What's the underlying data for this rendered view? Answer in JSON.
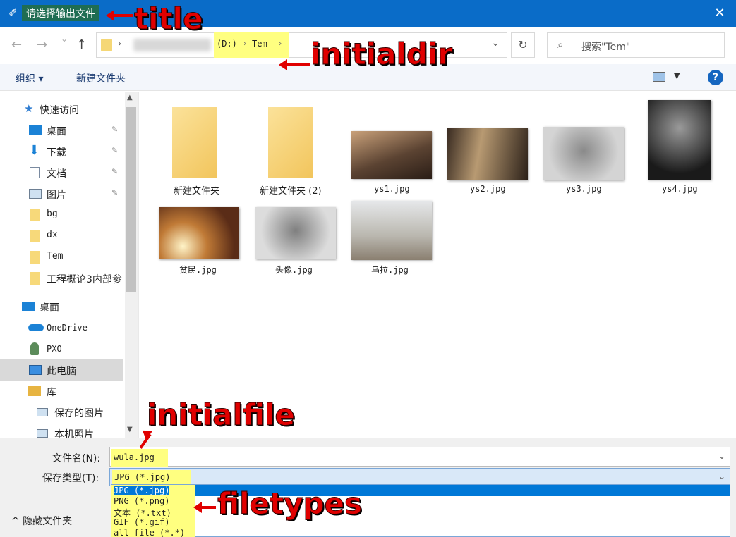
{
  "titlebar": {
    "title": "请选择输出文件",
    "close_glyph": "✕",
    "icon": "feather-icon"
  },
  "nav": {
    "back_glyph": "←",
    "forward_glyph": "→",
    "recent_glyph": "⌄",
    "up_glyph": "↑",
    "address": {
      "drive": "(D:)",
      "folder": "Tem",
      "separator": "›"
    },
    "refresh_glyph": "↻",
    "search_placeholder": "搜索\"Tem\""
  },
  "toolbar": {
    "organize_label": "组织 ▾",
    "new_folder_label": "新建文件夹",
    "help_label": "?"
  },
  "sidebar": {
    "items": [
      {
        "label": "快速访问",
        "icon": "star-icon"
      },
      {
        "label": "桌面",
        "icon": "desktop-icon",
        "pinned": true
      },
      {
        "label": "下载",
        "icon": "download-icon",
        "pinned": true
      },
      {
        "label": "文档",
        "icon": "document-icon",
        "pinned": true
      },
      {
        "label": "图片",
        "icon": "picture-icon",
        "pinned": true
      },
      {
        "label": "bg",
        "icon": "folder-icon"
      },
      {
        "label": "dx",
        "icon": "folder-icon"
      },
      {
        "label": "Tem",
        "icon": "folder-icon"
      },
      {
        "label": "工程概论3内部参",
        "icon": "folder-icon"
      },
      {
        "label": "桌面",
        "icon": "desktop-icon"
      },
      {
        "label": "OneDrive",
        "icon": "cloud-icon"
      },
      {
        "label": "PXO",
        "icon": "user-icon"
      },
      {
        "label": "此电脑",
        "icon": "computer-icon",
        "selected": true
      },
      {
        "label": "库",
        "icon": "library-icon"
      },
      {
        "label": "保存的图片",
        "icon": "picture-icon"
      },
      {
        "label": "本机照片",
        "icon": "picture-icon"
      }
    ],
    "pin_glyph": "📌"
  },
  "files": [
    {
      "name": "新建文件夹",
      "type": "folder"
    },
    {
      "name": "新建文件夹 (2)",
      "type": "folder"
    },
    {
      "name": "ys1.jpg",
      "type": "image"
    },
    {
      "name": "ys2.jpg",
      "type": "image"
    },
    {
      "name": "ys3.jpg",
      "type": "image"
    },
    {
      "name": "ys4.jpg",
      "type": "image"
    },
    {
      "name": "贫民.jpg",
      "type": "image"
    },
    {
      "name": "头像.jpg",
      "type": "image"
    },
    {
      "name": "乌拉.jpg",
      "type": "image"
    }
  ],
  "bottom": {
    "filename_label": "文件名(N):",
    "filename_value": "wula.jpg",
    "filetype_label": "保存类型(T):",
    "filetype_value": "JPG (*.jpg)",
    "filetype_options": [
      "JPG (*.jpg)",
      "PNG (*.png)",
      "文本 (*.txt)",
      "GIF (*.gif)",
      "all file (*.*)"
    ],
    "hide_folders_label": "^ 隐藏文件夹",
    "dropdown_glyph": "⌄"
  },
  "annotations": {
    "title": "title",
    "initialdir": "initialdir",
    "initialfile": "initialfile",
    "filetypes": "filetypes"
  },
  "colors": {
    "titlebar": "#0a6cc8",
    "highlight": "#ffff80",
    "annotation": "#e00000",
    "selection": "#0078d7"
  }
}
